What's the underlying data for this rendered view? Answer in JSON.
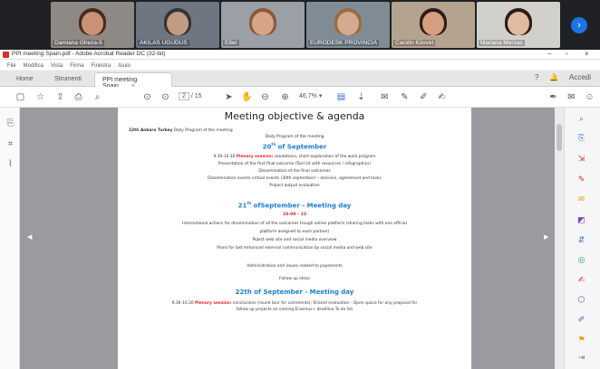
{
  "participants": [
    {
      "name": "Damiana Gheza-5",
      "bg": "#8d8a86",
      "skin": "#c99276",
      "hair": "#4a2a1a"
    },
    {
      "name": "AKILAS UGUDUS",
      "bg": "#6e7682",
      "skin": "#c29c82",
      "hair": "#333333"
    },
    {
      "name": "Etter",
      "bg": "#9aa0a6",
      "skin": "#d7a487",
      "hair": "#8a5a3a"
    },
    {
      "name": "EURODESK PROVINCIA",
      "bg": "#7f8c96",
      "skin": "#d4ab90",
      "hair": "#9b6b3c"
    },
    {
      "name": "Carolin Küvvet",
      "bg": "#b4a38e",
      "skin": "#d6a080",
      "hair": "#2e1d14"
    },
    {
      "name": "Mariana Mersas",
      "bg": "#d2d0cc",
      "skin": "#e2b9a1",
      "hair": "#2a1c16"
    }
  ],
  "video_next_icon": "chevron-right-icon",
  "window": {
    "title": "PPt meeting Spain.pdf - Adobe Acrobat Reader DC (32-bit)",
    "minimize": "–",
    "maximize": "▫",
    "close": "×"
  },
  "menu": [
    "File",
    "Modifica",
    "Vista",
    "Firma",
    "Finestra",
    "Aiuto"
  ],
  "tabs": {
    "home": "Home",
    "tools": "Strumenti",
    "document": "PPt meeting Spain...",
    "close": "×"
  },
  "account": {
    "help": "?",
    "notifications": "🔔",
    "signin": "Accedi"
  },
  "toolbar": {
    "page_current": "2",
    "page_total": "/ 15",
    "zoom": "46,7%",
    "zoom_caret": "▾"
  },
  "document": {
    "title": "Meeting objective & agenda",
    "intro_bold": "22th Ankara Turkey",
    "intro": " Daily Program of the meeting",
    "daily": "Daily Program of the meeting",
    "day1": {
      "heading": "20",
      "sup": "th",
      "rest": " of September"
    },
    "day1_lines": [
      {
        "prefix": "9.30-10.30 ",
        "red": "Plenary session:",
        "text": " salutations, short explanation of the work program"
      },
      {
        "prefix": "",
        "red": "",
        "text": "Presentation of the first final outcome (Tool kit with resources / infographics)"
      },
      {
        "prefix": "",
        "red": "",
        "text": "Dissemination of the final outcomes"
      },
      {
        "prefix": "",
        "red": "",
        "text": "Dissemination events virtual events (30th september) – decision, agreement and tasks"
      },
      {
        "prefix": "",
        "red": "",
        "text": "Project output evaluation"
      }
    ],
    "day2": {
      "heading": "21",
      "sup": "th",
      "rest": " ofSeptember - Meeting day"
    },
    "day2_time": "10.00 - 13",
    "day2_lines": [
      "International actions for dissemination of all the outcomes trough online platform (sharing tasks with one official",
      "platform assigned to each partner)",
      "Poject web site and social media overview",
      "Plans for last  enhanced external communication by social media and web site"
    ],
    "admin": "Administration and issues related to payements",
    "followup": "Follow up ideas",
    "day3": {
      "heading": "22th",
      "rest": " of September - Meeting day"
    },
    "day3_prefix": "9.30-10.30 ",
    "day3_red": "Plenary session:",
    "day3_text": " conclusions (round tour for comments); Shared evaluation - Open space for any proposal for",
    "day3_text2": "follow up projects on coming Erasmus+ deadline To do list"
  },
  "colors": {
    "heading_blue": "#1d7fd6",
    "plenary_red": "#e02424",
    "acrobat_red": "#d93025",
    "link_blue": "#1a73e8"
  }
}
